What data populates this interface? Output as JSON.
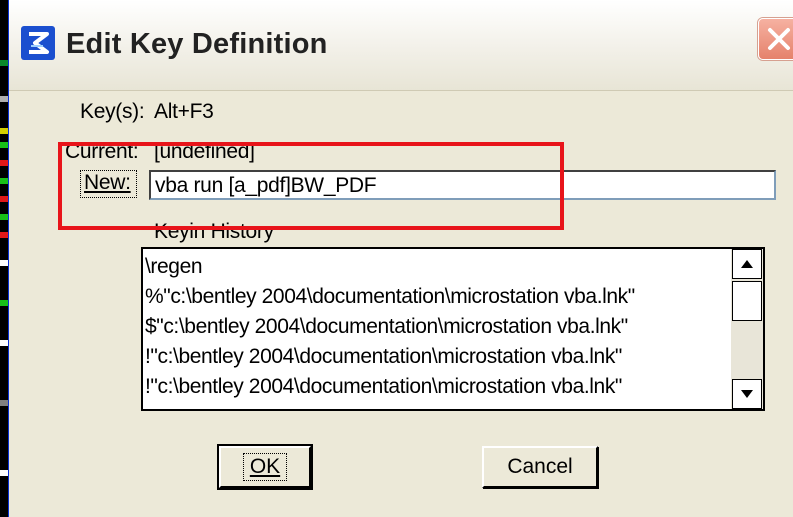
{
  "window": {
    "title": "Edit Key Definition"
  },
  "form": {
    "keys_label": "Key(s):",
    "keys_value": "Alt+F3",
    "current_label": "Current:",
    "current_value": "[undefined]",
    "new_label": "New:",
    "new_value": "vba run [a_pdf]BW_PDF",
    "history_label": "Keyin History"
  },
  "history": {
    "items": [
      "\\regen",
      "%\"c:\\bentley 2004\\documentation\\microstation vba.lnk\"",
      "$\"c:\\bentley 2004\\documentation\\microstation vba.lnk\"",
      "!\"c:\\bentley 2004\\documentation\\microstation vba.lnk\"",
      "!\"c:\\bentley 2004\\documentation\\microstation vba.lnk\""
    ]
  },
  "buttons": {
    "ok_label": "OK",
    "cancel_label": "Cancel"
  },
  "colors": {
    "highlight": "#e8141a",
    "dialog_bg": "#ece9d8"
  },
  "icons": {
    "app": "microstation-icon",
    "close": "close-icon",
    "scroll_up": "scroll-up-arrow-icon",
    "scroll_down": "scroll-down-arrow-icon"
  }
}
